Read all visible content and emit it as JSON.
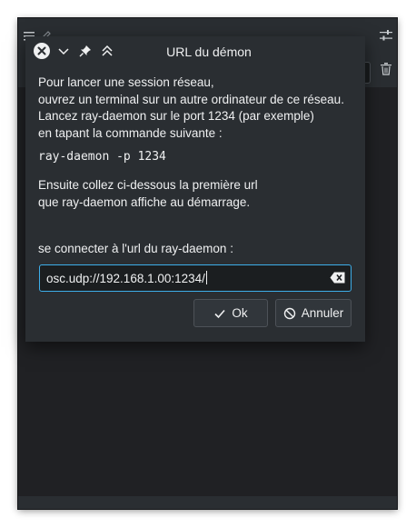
{
  "dialog": {
    "title": "URL du démon",
    "message_lines": [
      "Pour lancer une session réseau,",
      "ouvrez un terminal sur un autre ordinateur de ce réseau.",
      "Lancez ray-daemon sur le port 1234 (par exemple)",
      "en tapant la commande suivante :"
    ],
    "command": "ray-daemon -p 1234",
    "message2_lines": [
      "Ensuite collez ci-dessous la première url",
      "que ray-daemon affiche au démarrage."
    ],
    "url_label": "se connecter à l'url du ray-daemon :",
    "url_value": "osc.udp://192.168.1.00:1234/",
    "ok_label": "Ok",
    "cancel_label": "Annuler"
  },
  "icons": {
    "titlebar": [
      "close-icon",
      "chevron-down-icon",
      "pin-icon",
      "keep-above-icon"
    ],
    "main_window": [
      "menu-icon",
      "edit-icon",
      "settings-icon",
      "trash-icon"
    ],
    "buttons": [
      "checkmark-icon",
      "cancel-icon"
    ],
    "input": "clear-text-icon"
  },
  "colors": {
    "dialog_bg": "#2a2e32",
    "input_bg": "#1b1e20",
    "focus_border": "#3daee9",
    "text": "#eff0f1"
  }
}
